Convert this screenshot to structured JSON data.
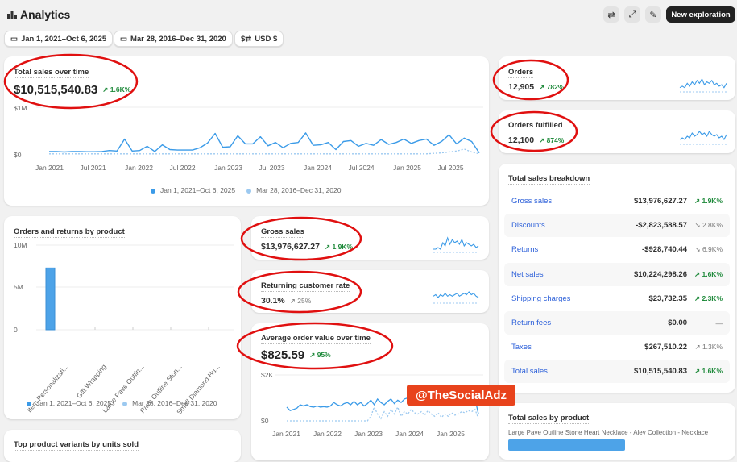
{
  "header": {
    "title": "Analytics",
    "new_exploration": "New exploration"
  },
  "filters": {
    "date_range": "Jan 1, 2021–Oct 6, 2025",
    "compare_range": "Mar 28, 2016–Dec 31, 2020",
    "currency": "USD $"
  },
  "legend": {
    "current": "Jan 1, 2021–Oct 6, 2025",
    "previous": "Mar 28, 2016–Dec 31, 2020"
  },
  "colors": {
    "current": "#3b9be8",
    "previous": "#9cc9f0",
    "up": "#1f8a3b",
    "link": "#2b5fd9",
    "annotation": "#e01010",
    "watermark": "#e8431c"
  },
  "total_sales": {
    "title": "Total sales over time",
    "value": "$10,515,540.83",
    "change": "1.6K%",
    "y_ticks": [
      "$1M",
      "$0"
    ],
    "x_ticks": [
      "Jan 2021",
      "Jul 2021",
      "Jan 2022",
      "Jul 2022",
      "Jan 2023",
      "Jul 2023",
      "Jan 2024",
      "Jul 2024",
      "Jan 2025",
      "Jul 2025"
    ]
  },
  "orders": {
    "title": "Orders",
    "value": "12,905",
    "change": "782%"
  },
  "orders_fulfilled": {
    "title": "Orders fulfilled",
    "value": "12,100",
    "change": "874%"
  },
  "gross_sales": {
    "title": "Gross sales",
    "value": "$13,976,627.27",
    "change": "1.9K%"
  },
  "returning": {
    "title": "Returning customer rate",
    "value": "30.1%",
    "change": "25%"
  },
  "aov": {
    "title": "Average order value over time",
    "value": "$825.59",
    "change": "95%",
    "y_ticks": [
      "$2K",
      "$0"
    ],
    "x_ticks": [
      "Jan 2021",
      "Jan 2022",
      "Jan 2023",
      "Jan 2024",
      "Jan 2025"
    ]
  },
  "orders_returns": {
    "title": "Orders and returns by product",
    "y_ticks": [
      "10M",
      "5M",
      "0"
    ],
    "categories": [
      "Item Personalizati...",
      "Gift Wrapping",
      "Large Pave Outlin...",
      "Pave Outline Ston...",
      "Small Diamond Hu..."
    ]
  },
  "breakdown": {
    "title": "Total sales breakdown",
    "rows": [
      {
        "label": "Gross sales",
        "value": "$13,976,627.27",
        "change": "1.9K%",
        "dir": "up"
      },
      {
        "label": "Discounts",
        "value": "-$2,823,588.57",
        "change": "2.8K%",
        "dir": "down"
      },
      {
        "label": "Returns",
        "value": "-$928,740.44",
        "change": "6.9K%",
        "dir": "down"
      },
      {
        "label": "Net sales",
        "value": "$10,224,298.26",
        "change": "1.6K%",
        "dir": "up"
      },
      {
        "label": "Shipping charges",
        "value": "$23,732.35",
        "change": "2.3K%",
        "dir": "up"
      },
      {
        "label": "Return fees",
        "value": "$0.00",
        "change": "—",
        "dir": "none"
      },
      {
        "label": "Taxes",
        "value": "$267,510.22",
        "change": "1.3K%",
        "dir": "neutral"
      },
      {
        "label": "Total sales",
        "value": "$10,515,540.83",
        "change": "1.6K%",
        "dir": "up"
      }
    ]
  },
  "sales_by_product": {
    "title": "Total sales by product",
    "first_product": "Large Pave Outline Stone Heart Necklace - Alev Collection - Necklace"
  },
  "top_variants": {
    "title": "Top product variants by units sold"
  },
  "watermark": "@TheSocialAdz",
  "chart_data": [
    {
      "type": "line",
      "title": "Total sales over time",
      "ylabel": "",
      "ylim": [
        0,
        1000000
      ],
      "x_start": "Jan 2021",
      "x_step": "month",
      "series": [
        {
          "name": "Jan 1, 2021–Oct 6, 2025",
          "values": [
            70000,
            70000,
            60000,
            70000,
            70000,
            65000,
            65000,
            70000,
            90000,
            80000,
            330000,
            80000,
            90000,
            180000,
            70000,
            210000,
            110000,
            100000,
            100000,
            100000,
            150000,
            250000,
            450000,
            160000,
            170000,
            400000,
            230000,
            230000,
            380000,
            190000,
            260000,
            150000,
            240000,
            260000,
            460000,
            200000,
            210000,
            260000,
            110000,
            280000,
            300000,
            180000,
            240000,
            200000,
            320000,
            220000,
            260000,
            330000,
            240000,
            300000,
            330000,
            200000,
            280000,
            420000,
            230000,
            350000,
            280000,
            40000
          ]
        },
        {
          "name": "Mar 28, 2016–Dec 31, 2020",
          "values": [
            20000,
            20000,
            20000,
            20000,
            20000,
            20000,
            20000,
            20000,
            20000,
            20000,
            20000,
            20000,
            20000,
            20000,
            20000,
            20000,
            20000,
            20000,
            20000,
            20000,
            20000,
            20000,
            20000,
            20000,
            20000,
            20000,
            20000,
            20000,
            20000,
            20000,
            20000,
            20000,
            20000,
            20000,
            20000,
            20000,
            20000,
            20000,
            20000,
            20000,
            20000,
            20000,
            20000,
            20000,
            20000,
            20000,
            20000,
            20000,
            20000,
            20000,
            20000,
            30000,
            40000,
            60000,
            80000,
            120000,
            60000,
            20000
          ]
        }
      ]
    },
    {
      "type": "line",
      "title": "Average order value over time",
      "ylim": [
        0,
        2000
      ],
      "series": [
        {
          "name": "Jan 1, 2021–Oct 6, 2025",
          "values": [
            600,
            450,
            500,
            550,
            700,
            650,
            700,
            620,
            600,
            650,
            600,
            620,
            600,
            650,
            800,
            700,
            650,
            750,
            800,
            700,
            850,
            700,
            800,
            650,
            750,
            900,
            700,
            950,
            800,
            700,
            850,
            950,
            750,
            900,
            800,
            950,
            1000,
            850,
            1050,
            900,
            1000,
            950,
            1100,
            900,
            1000,
            1050,
            950,
            1100,
            1000,
            900,
            1050,
            1100,
            950,
            1000,
            1150,
            1050,
            950,
            300
          ]
        },
        {
          "name": "Mar 28, 2016–Dec 31, 2020",
          "values": [
            0,
            0,
            0,
            0,
            0,
            0,
            0,
            0,
            0,
            0,
            0,
            0,
            0,
            0,
            0,
            0,
            0,
            0,
            0,
            0,
            0,
            0,
            0,
            0,
            0,
            200,
            600,
            300,
            100,
            400,
            200,
            500,
            300,
            600,
            200,
            400,
            300,
            500,
            350,
            300,
            400,
            250,
            450,
            300,
            200,
            350,
            150,
            300,
            200,
            350,
            250,
            300,
            400,
            350,
            450,
            400,
            500,
            100
          ]
        }
      ]
    },
    {
      "type": "bar",
      "title": "Orders and returns by product",
      "categories": [
        "Item Personalizati...",
        "Gift Wrapping",
        "Large Pave Outlin...",
        "Pave Outline Ston...",
        "Small Diamond Hu..."
      ],
      "values": [
        7300000,
        0,
        0,
        0,
        0
      ],
      "ylim": [
        0,
        10000000
      ]
    }
  ],
  "sparklines": {
    "orders": [
      3,
      4,
      3,
      6,
      4,
      7,
      5,
      8,
      6,
      9,
      5,
      7,
      6,
      8,
      5,
      6,
      4,
      5,
      3,
      6
    ],
    "orders_fulfilled": [
      3,
      4,
      3,
      5,
      4,
      7,
      5,
      6,
      8,
      6,
      7,
      5,
      8,
      6,
      5,
      6,
      4,
      5,
      3,
      6
    ],
    "gross_sales": [
      2,
      2,
      3,
      2,
      6,
      4,
      9,
      5,
      8,
      6,
      7,
      5,
      8,
      4,
      6,
      5,
      4,
      5,
      3,
      4
    ],
    "returning": [
      5,
      6,
      4,
      6,
      5,
      7,
      5,
      6,
      5,
      6,
      7,
      5,
      6,
      7,
      6,
      8,
      6,
      7,
      5,
      4
    ]
  }
}
